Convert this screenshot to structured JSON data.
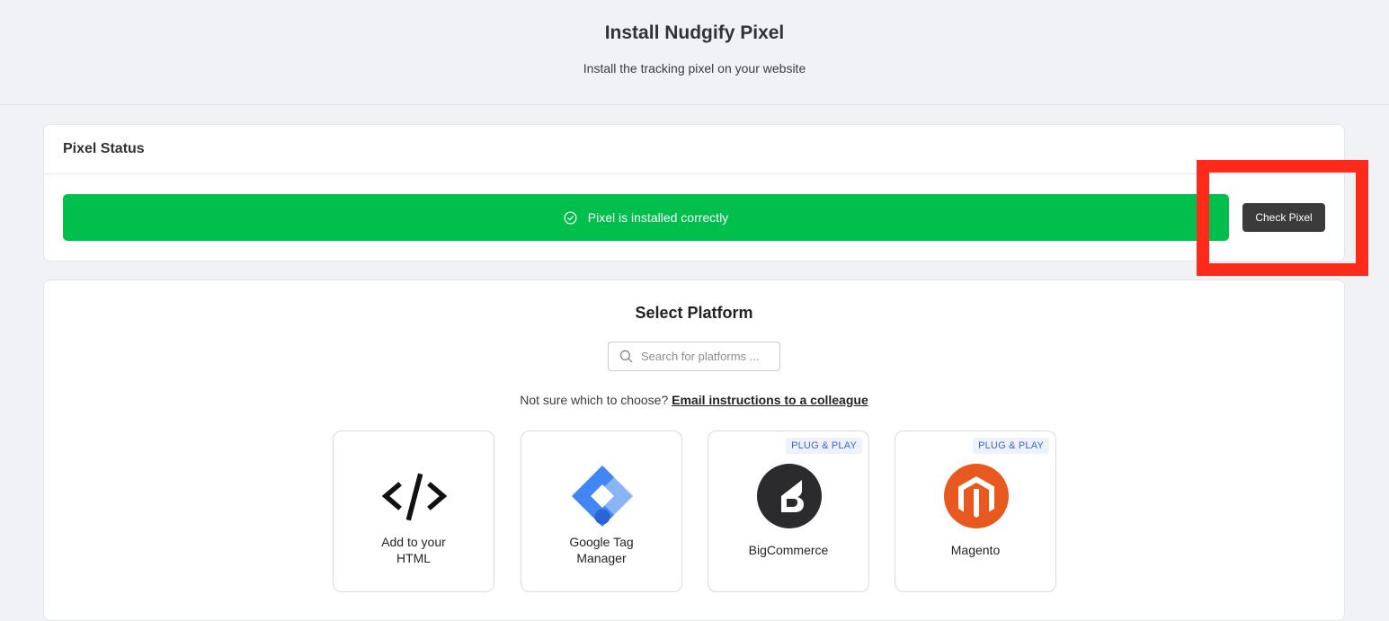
{
  "header": {
    "title": "Install Nudgify Pixel",
    "subtitle": "Install the tracking pixel on your website"
  },
  "status": {
    "card_title": "Pixel Status",
    "message": "Pixel is installed correctly",
    "check_button": "Check Pixel",
    "bar_color": "#00bf4c",
    "highlight_color": "#ff2a1a"
  },
  "platforms": {
    "title": "Select Platform",
    "search_placeholder": "Search for platforms ...",
    "help_text": "Not sure which to choose?",
    "help_link": "Email instructions to a colleague",
    "items": [
      {
        "label_line1": "Add to your",
        "label_line2": "HTML",
        "icon": "code-icon",
        "badge": ""
      },
      {
        "label_line1": "Google Tag",
        "label_line2": "Manager",
        "icon": "google-tag-manager-icon",
        "badge": ""
      },
      {
        "label": "BigCommerce",
        "icon": "bigcommerce-icon",
        "badge": "PLUG & PLAY"
      },
      {
        "label": "Magento",
        "icon": "magento-icon",
        "badge": "PLUG & PLAY"
      }
    ]
  }
}
